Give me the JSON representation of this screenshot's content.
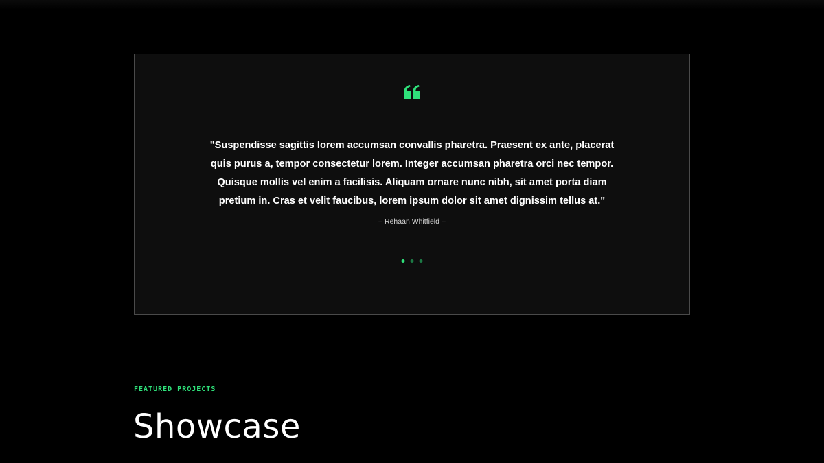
{
  "colors": {
    "accent": "#2fe17a",
    "background": "#000000",
    "card_background": "#0e0e0e",
    "card_border": "#4a4a4a"
  },
  "testimonial": {
    "quote_icon": "quote-icon",
    "quote": "\"Suspendisse sagittis lorem accumsan convallis pharetra. Praesent ex ante, placerat quis purus a, tempor consectetur lorem. Integer accumsan pharetra orci nec tempor. Quisque mollis vel enim a facilisis. Aliquam ornare nunc nibh, sit amet porta diam pretium in. Cras et velit faucibus, lorem ipsum dolor sit amet dignissim tellus at.\"",
    "author": "– Rehaan Whitfield –",
    "pagination": {
      "count": 3,
      "active_index": 0
    }
  },
  "featured": {
    "eyebrow": "FEATURED PROJECTS",
    "title": "Showcase"
  }
}
